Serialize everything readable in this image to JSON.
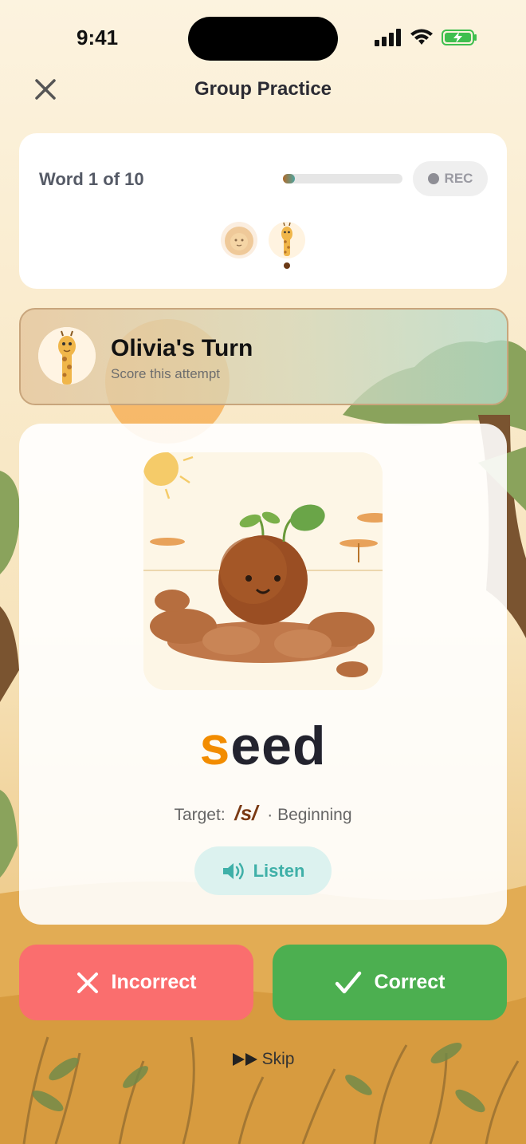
{
  "status_bar": {
    "time": "9:41"
  },
  "header": {
    "title": "Group Practice"
  },
  "progress": {
    "word_count_label": "Word 1 of 10",
    "progress_fraction": 0.1,
    "rec_label": "REC",
    "players": [
      "lion",
      "giraffe"
    ],
    "active_player": "giraffe"
  },
  "turn": {
    "name": "Olivia's Turn",
    "subtitle": "Score this attempt",
    "avatar_icon": "giraffe-avatar"
  },
  "word_card": {
    "illustration": "smiling-seed-sprouting-in-soil",
    "word_highlight": "s",
    "word_rest": "eed",
    "target_label": "Target:",
    "phoneme": "/s/",
    "separator": "·",
    "position": "Beginning",
    "listen_label": "Listen",
    "listen_icon": "speaker-icon"
  },
  "actions": {
    "incorrect_label": "Incorrect",
    "correct_label": "Correct",
    "skip_label": "Skip"
  },
  "colors": {
    "accent_orange": "#f28c00",
    "incorrect": "#fa6e6e",
    "correct": "#4caf50",
    "listen": "#3fb0a8"
  }
}
